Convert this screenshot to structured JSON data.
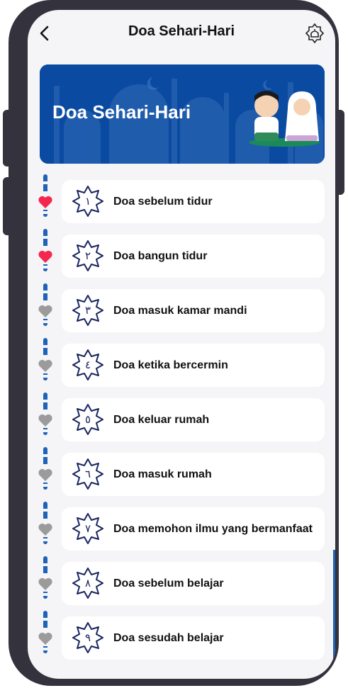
{
  "header": {
    "title": "Doa Sehari-Hari",
    "back_icon": "chevron-left-icon",
    "mosque_icon": "mosque-icon"
  },
  "banner": {
    "title": "Doa Sehari-Hari",
    "background_color": "#0a4aa0"
  },
  "colors": {
    "favorite_active": "#f4284f",
    "favorite_inactive": "#9b9b9b",
    "timeline": "#1e63b8",
    "badge_outline": "#1b2560"
  },
  "items": [
    {
      "number": "١",
      "label": "Doa sebelum tidur",
      "favorite": true
    },
    {
      "number": "٢",
      "label": "Doa bangun tidur",
      "favorite": true
    },
    {
      "number": "٣",
      "label": "Doa masuk kamar mandi",
      "favorite": false
    },
    {
      "number": "٤",
      "label": "Doa ketika bercermin",
      "favorite": false
    },
    {
      "number": "٥",
      "label": "Doa keluar rumah",
      "favorite": false
    },
    {
      "number": "٦",
      "label": "Doa masuk rumah",
      "favorite": false
    },
    {
      "number": "٧",
      "label": "Doa memohon ilmu yang bermanfaat",
      "favorite": false
    },
    {
      "number": "٨",
      "label": "Doa sebelum belajar",
      "favorite": false
    },
    {
      "number": "٩",
      "label": "Doa sesudah belajar",
      "favorite": false
    }
  ]
}
